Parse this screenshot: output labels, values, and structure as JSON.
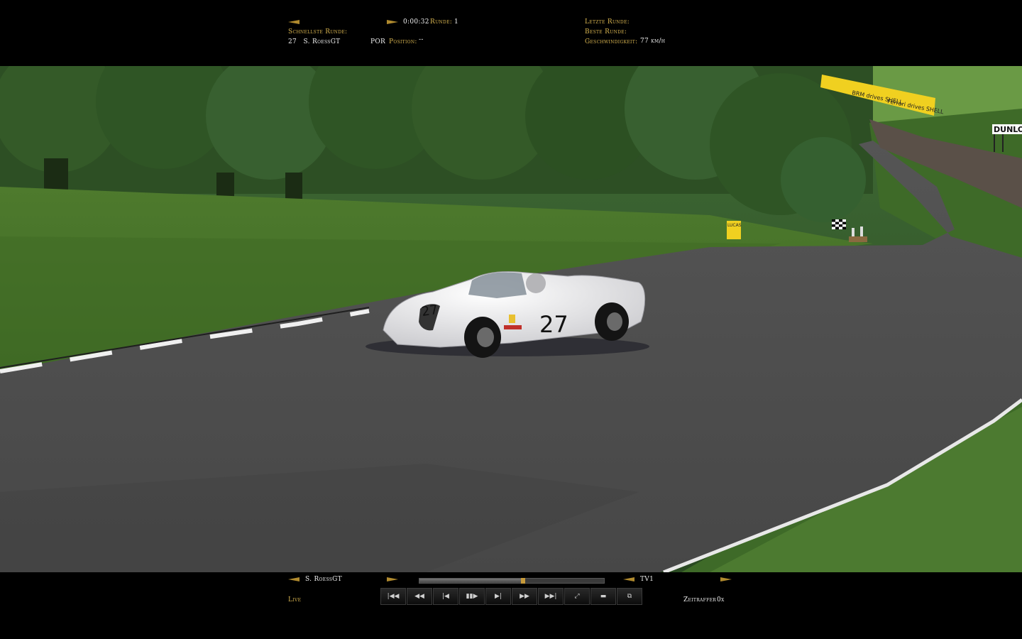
{
  "hud_top": {
    "time": "0:00:32",
    "lap_label": "Runde:",
    "lap_value": "1",
    "fastest_lap_label": "Schnellste Runde:",
    "fastest_lap_driver": "27   S. RoessGT",
    "driver_team": "POR",
    "position_label": "Position:",
    "position_value": "--",
    "last_lap_label": "Letzte Runde:",
    "best_lap_label": "Beste Runde:",
    "speed_label": "Geschwindigkeit:",
    "speed_value": "77 km/h"
  },
  "hud_bottom": {
    "driver_name": "S. RoessGT",
    "camera": "TV1",
    "live_label": "Live",
    "timelapse_label": "Zeitraffer",
    "timelapse_value": "0x",
    "replay_progress": 0.56
  },
  "controls": [
    {
      "name": "skip-to-start-button",
      "icon": "|◀◀"
    },
    {
      "name": "rewind-button",
      "icon": "◀◀"
    },
    {
      "name": "step-back-button",
      "icon": "|◀"
    },
    {
      "name": "play-pause-button",
      "icon": "▮▮▶"
    },
    {
      "name": "step-forward-button",
      "icon": "▶|"
    },
    {
      "name": "fast-forward-button",
      "icon": "▶▶"
    },
    {
      "name": "skip-to-end-button",
      "icon": "▶▶|"
    },
    {
      "name": "camera-button",
      "icon": "⤢"
    },
    {
      "name": "folder-button",
      "icon": "▬"
    },
    {
      "name": "window-button",
      "icon": "⧉"
    }
  ],
  "scene": {
    "car_number": "27",
    "signs": [
      "BRM drives SHELL",
      "Ferrari drives SHELL",
      "DUNLOP",
      "LUCAS"
    ]
  },
  "colors": {
    "hud_gold": "#d8b450",
    "hud_arrow": "#b08a2e",
    "track": "#4a4a4a",
    "grass": "#4f7a2e"
  }
}
